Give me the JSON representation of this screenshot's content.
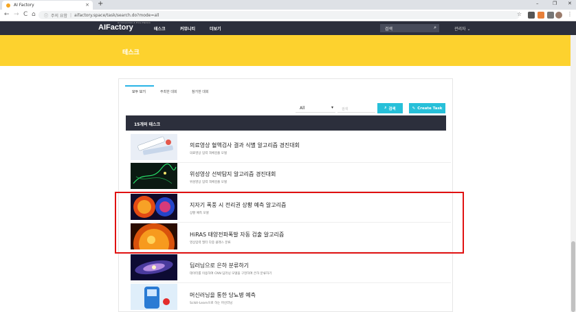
{
  "browser": {
    "tab_title": "AI Factory",
    "new_tab": "+",
    "close_tab": "×",
    "security_label": "주의 요함",
    "url": "aifactory.space/task/search.do?mode=all",
    "window_controls": [
      "–",
      "❐",
      "✕"
    ],
    "nav": {
      "back": "←",
      "forward": "→",
      "reload": "C",
      "home": "⌂"
    }
  },
  "site": {
    "logo": "AIFactory",
    "logo_tagline": "AI Competition & Prize Platform",
    "menu": [
      "테스크",
      "커뮤니티",
      "더보기"
    ],
    "search_placeholder": "검색",
    "admin_label": "관리자 ⌄"
  },
  "banner": {
    "title": "테스크"
  },
  "panel": {
    "tabs": [
      "모두 보기",
      "주최한 대회",
      "참가한 대회"
    ],
    "filter_value": "All",
    "keyword_placeholder": "검색",
    "search_button": "검색",
    "create_button": "Create Task",
    "count_label": "15개의 테스크"
  },
  "tasks": [
    {
      "title": "의료영상 혈액검사 결과 식별 알고리즘 경진대회",
      "subtitle": "의료영상 입력 객체검출 모델",
      "thumb": "lab-icon"
    },
    {
      "title": "위성영상 선박탐지 알고리즘 경진대회",
      "subtitle": "위성영상 입력 객체검출 모델",
      "thumb": "satellite-icon"
    },
    {
      "title": "지자기 폭풍 시 전리권 상황 예측 알고리즘",
      "subtitle": "상황 예측 모델",
      "thumb": "storm-icon"
    },
    {
      "title": "HiRAS 태양전파폭발 자동 검출 알고리즘",
      "subtitle": "영상입력 필터 다중 클래스 분류",
      "thumb": "sun-icon"
    },
    {
      "title": "딥러닝으로 은하 분류하기",
      "subtitle": "데이터를 이용하여 CNN 딥러닝 모델을 구현하여 은하 분류하기",
      "thumb": "galaxy-icon"
    },
    {
      "title": "머신러닝을 통한 당뇨병 예측",
      "subtitle": "Scikit-Learn으로 하는 머신러닝",
      "thumb": "glucose-icon"
    }
  ]
}
